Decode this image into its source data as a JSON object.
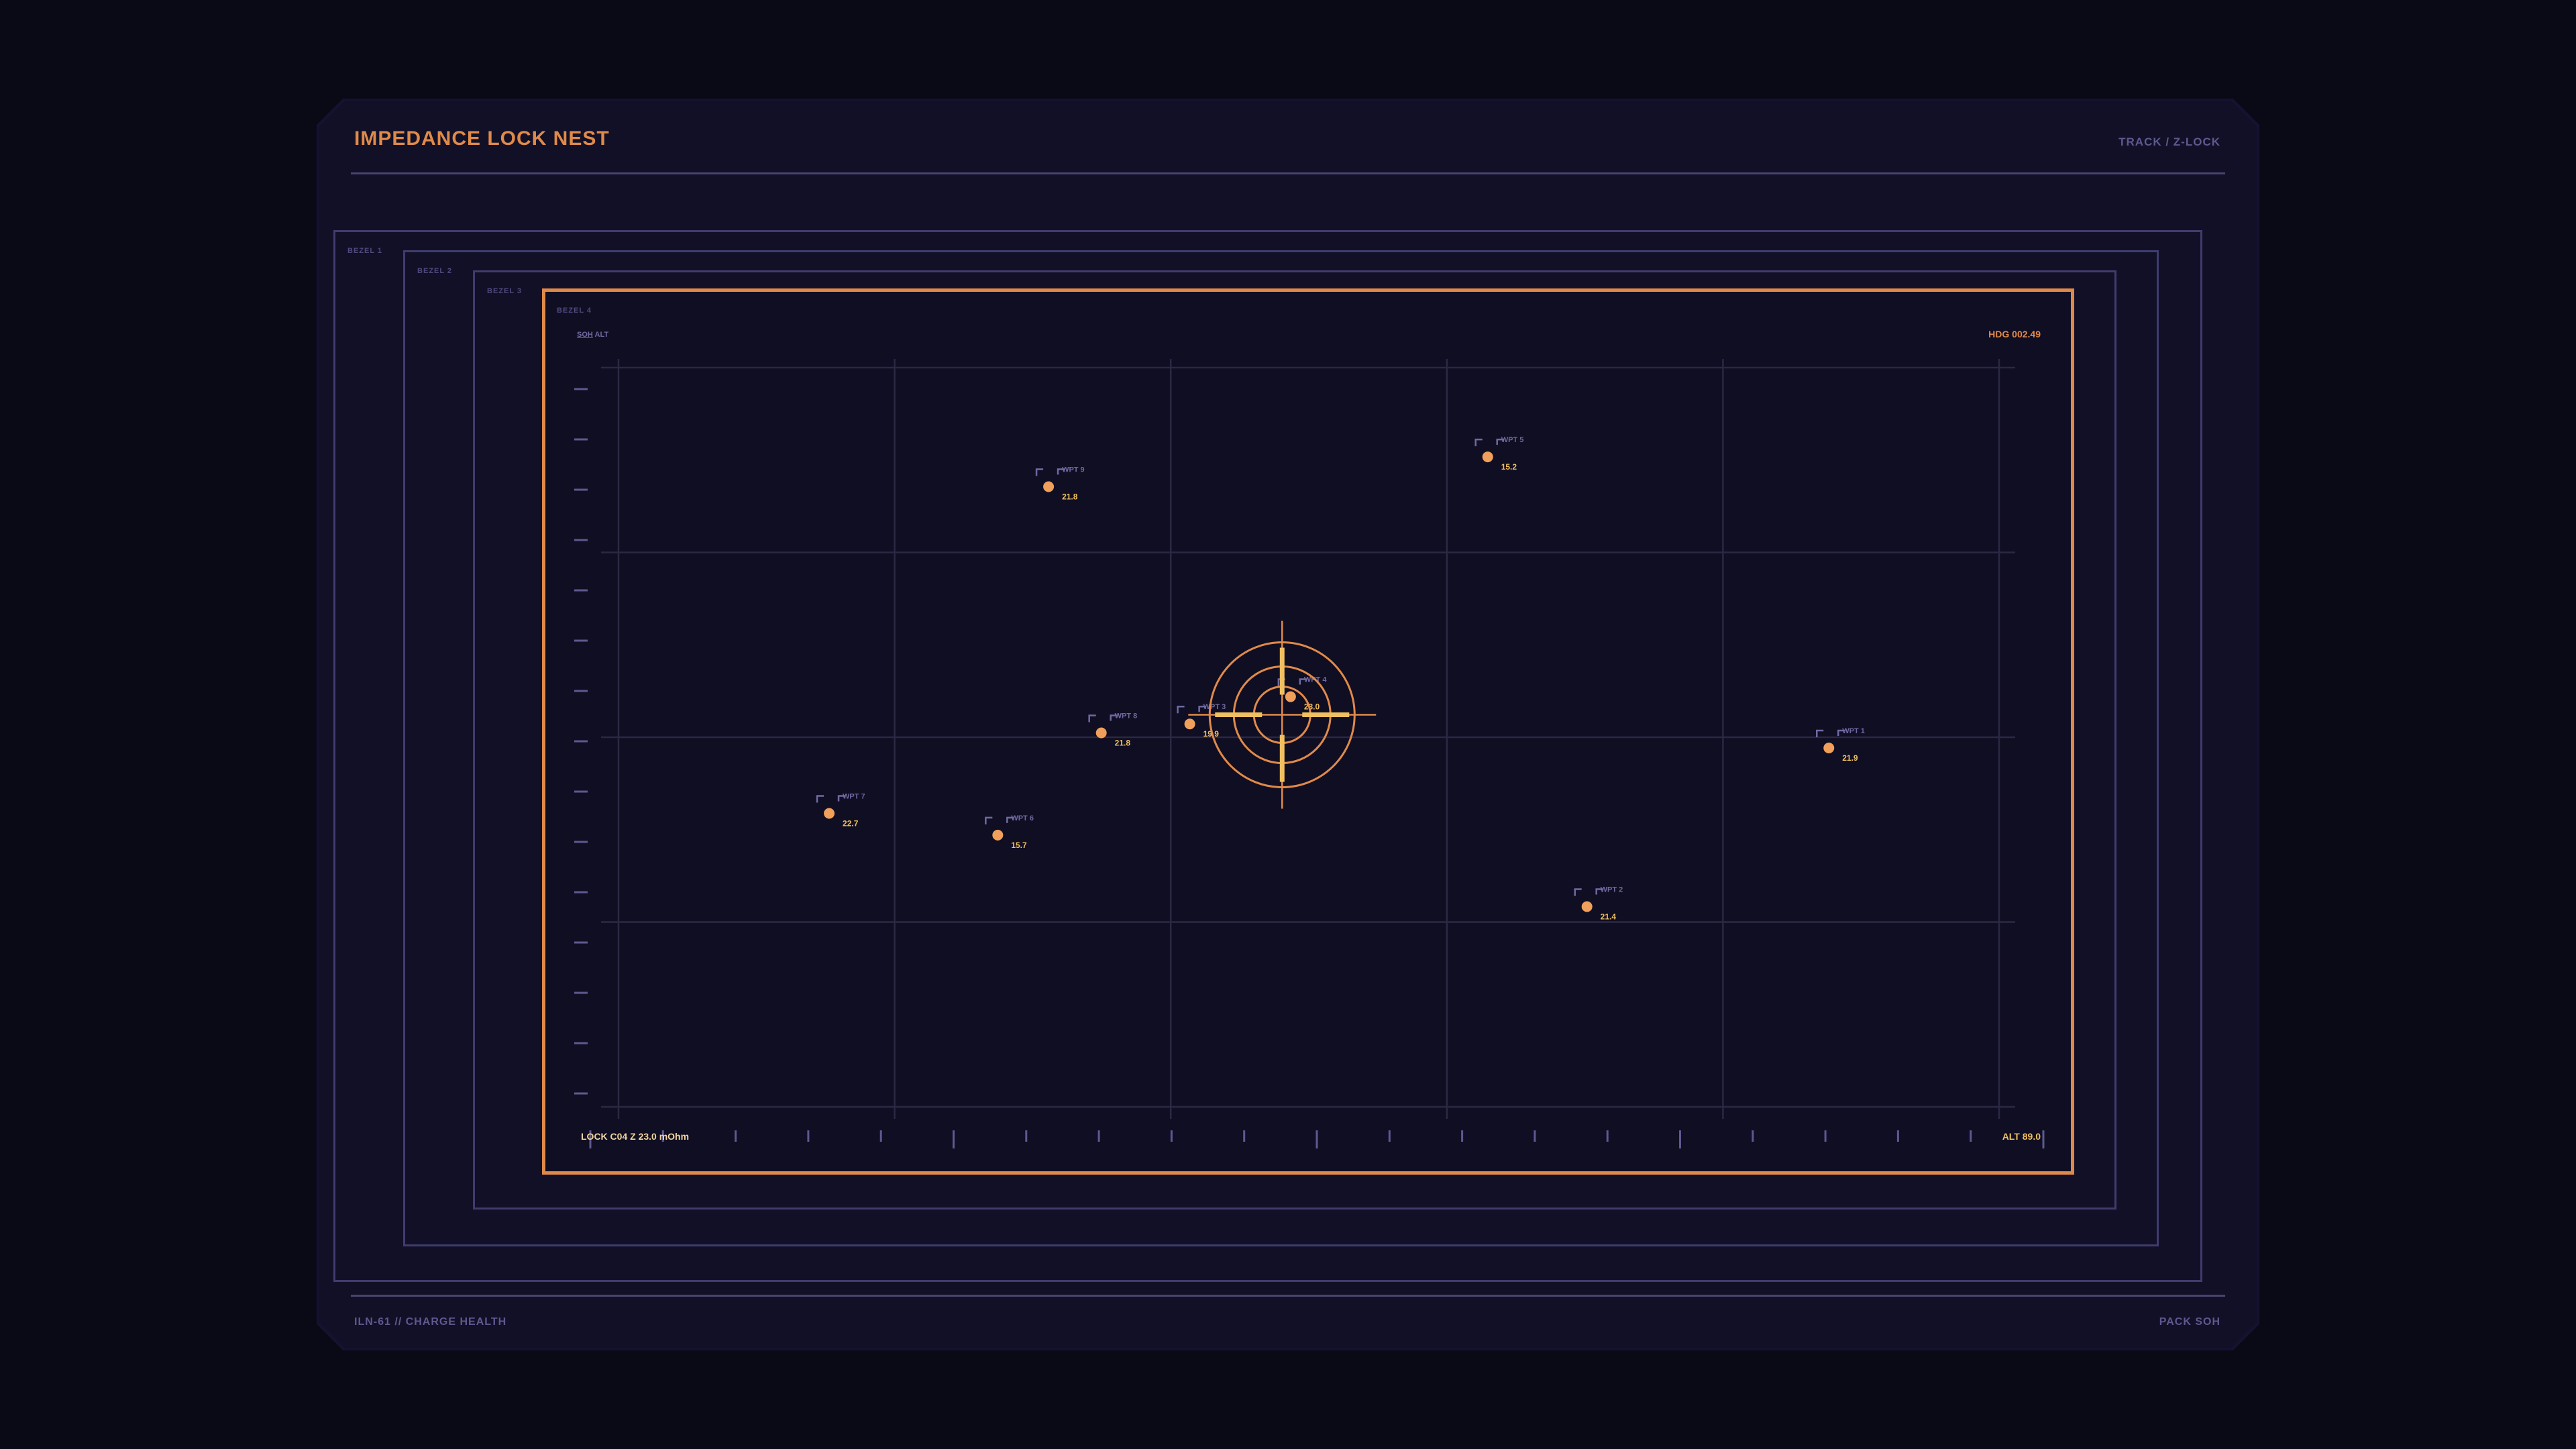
{
  "header": {
    "title": "IMPEDANCE LOCK NEST",
    "tag": "TRACK / Z-LOCK"
  },
  "footer": {
    "left": "ILN-61 // CHARGE HEALTH",
    "right": "PACK SOH"
  },
  "bezels": [
    "BEZEL 1",
    "BEZEL 2",
    "BEZEL 3",
    "BEZEL 4"
  ],
  "hud": {
    "top_left_a": "SOH",
    "top_left_b": "ALT",
    "top_right": "HDG 002.49",
    "bottom_left": "LOCK C04 Z 23.0 mOhm",
    "bottom_right": "ALT 89.0"
  },
  "colors": {
    "accent": "#e08a4a",
    "point": "#f0a05a",
    "value": "#f0c060",
    "label": "#6f6aa3",
    "grid": "#2b2844"
  },
  "cells": [
    {
      "name": "WPT 1",
      "value": "21.9",
      "fx": 0.8767,
      "fy": 0.5068
    },
    {
      "name": "WPT 2",
      "value": "21.4",
      "fx": 0.7015,
      "fy": 0.7208
    },
    {
      "name": "WPT 3",
      "value": "19.9",
      "fx": 0.4138,
      "fy": 0.4744
    },
    {
      "name": "WPT 4",
      "value": "23.0",
      "fx": 0.4868,
      "fy": 0.4376
    },
    {
      "name": "WPT 5",
      "value": "15.2",
      "fx": 0.6296,
      "fy": 0.1141
    },
    {
      "name": "WPT 6",
      "value": "15.7",
      "fx": 0.2747,
      "fy": 0.6243
    },
    {
      "name": "WPT 7",
      "value": "22.7",
      "fx": 0.1526,
      "fy": 0.595
    },
    {
      "name": "WPT 8",
      "value": "21.8",
      "fx": 0.3497,
      "fy": 0.4864
    },
    {
      "name": "WPT 9",
      "value": "21.8",
      "fx": 0.3115,
      "fy": 0.1543
    }
  ],
  "lock": {
    "cell": "WPT 4",
    "fx": 0.4807,
    "fy": 0.462
  }
}
